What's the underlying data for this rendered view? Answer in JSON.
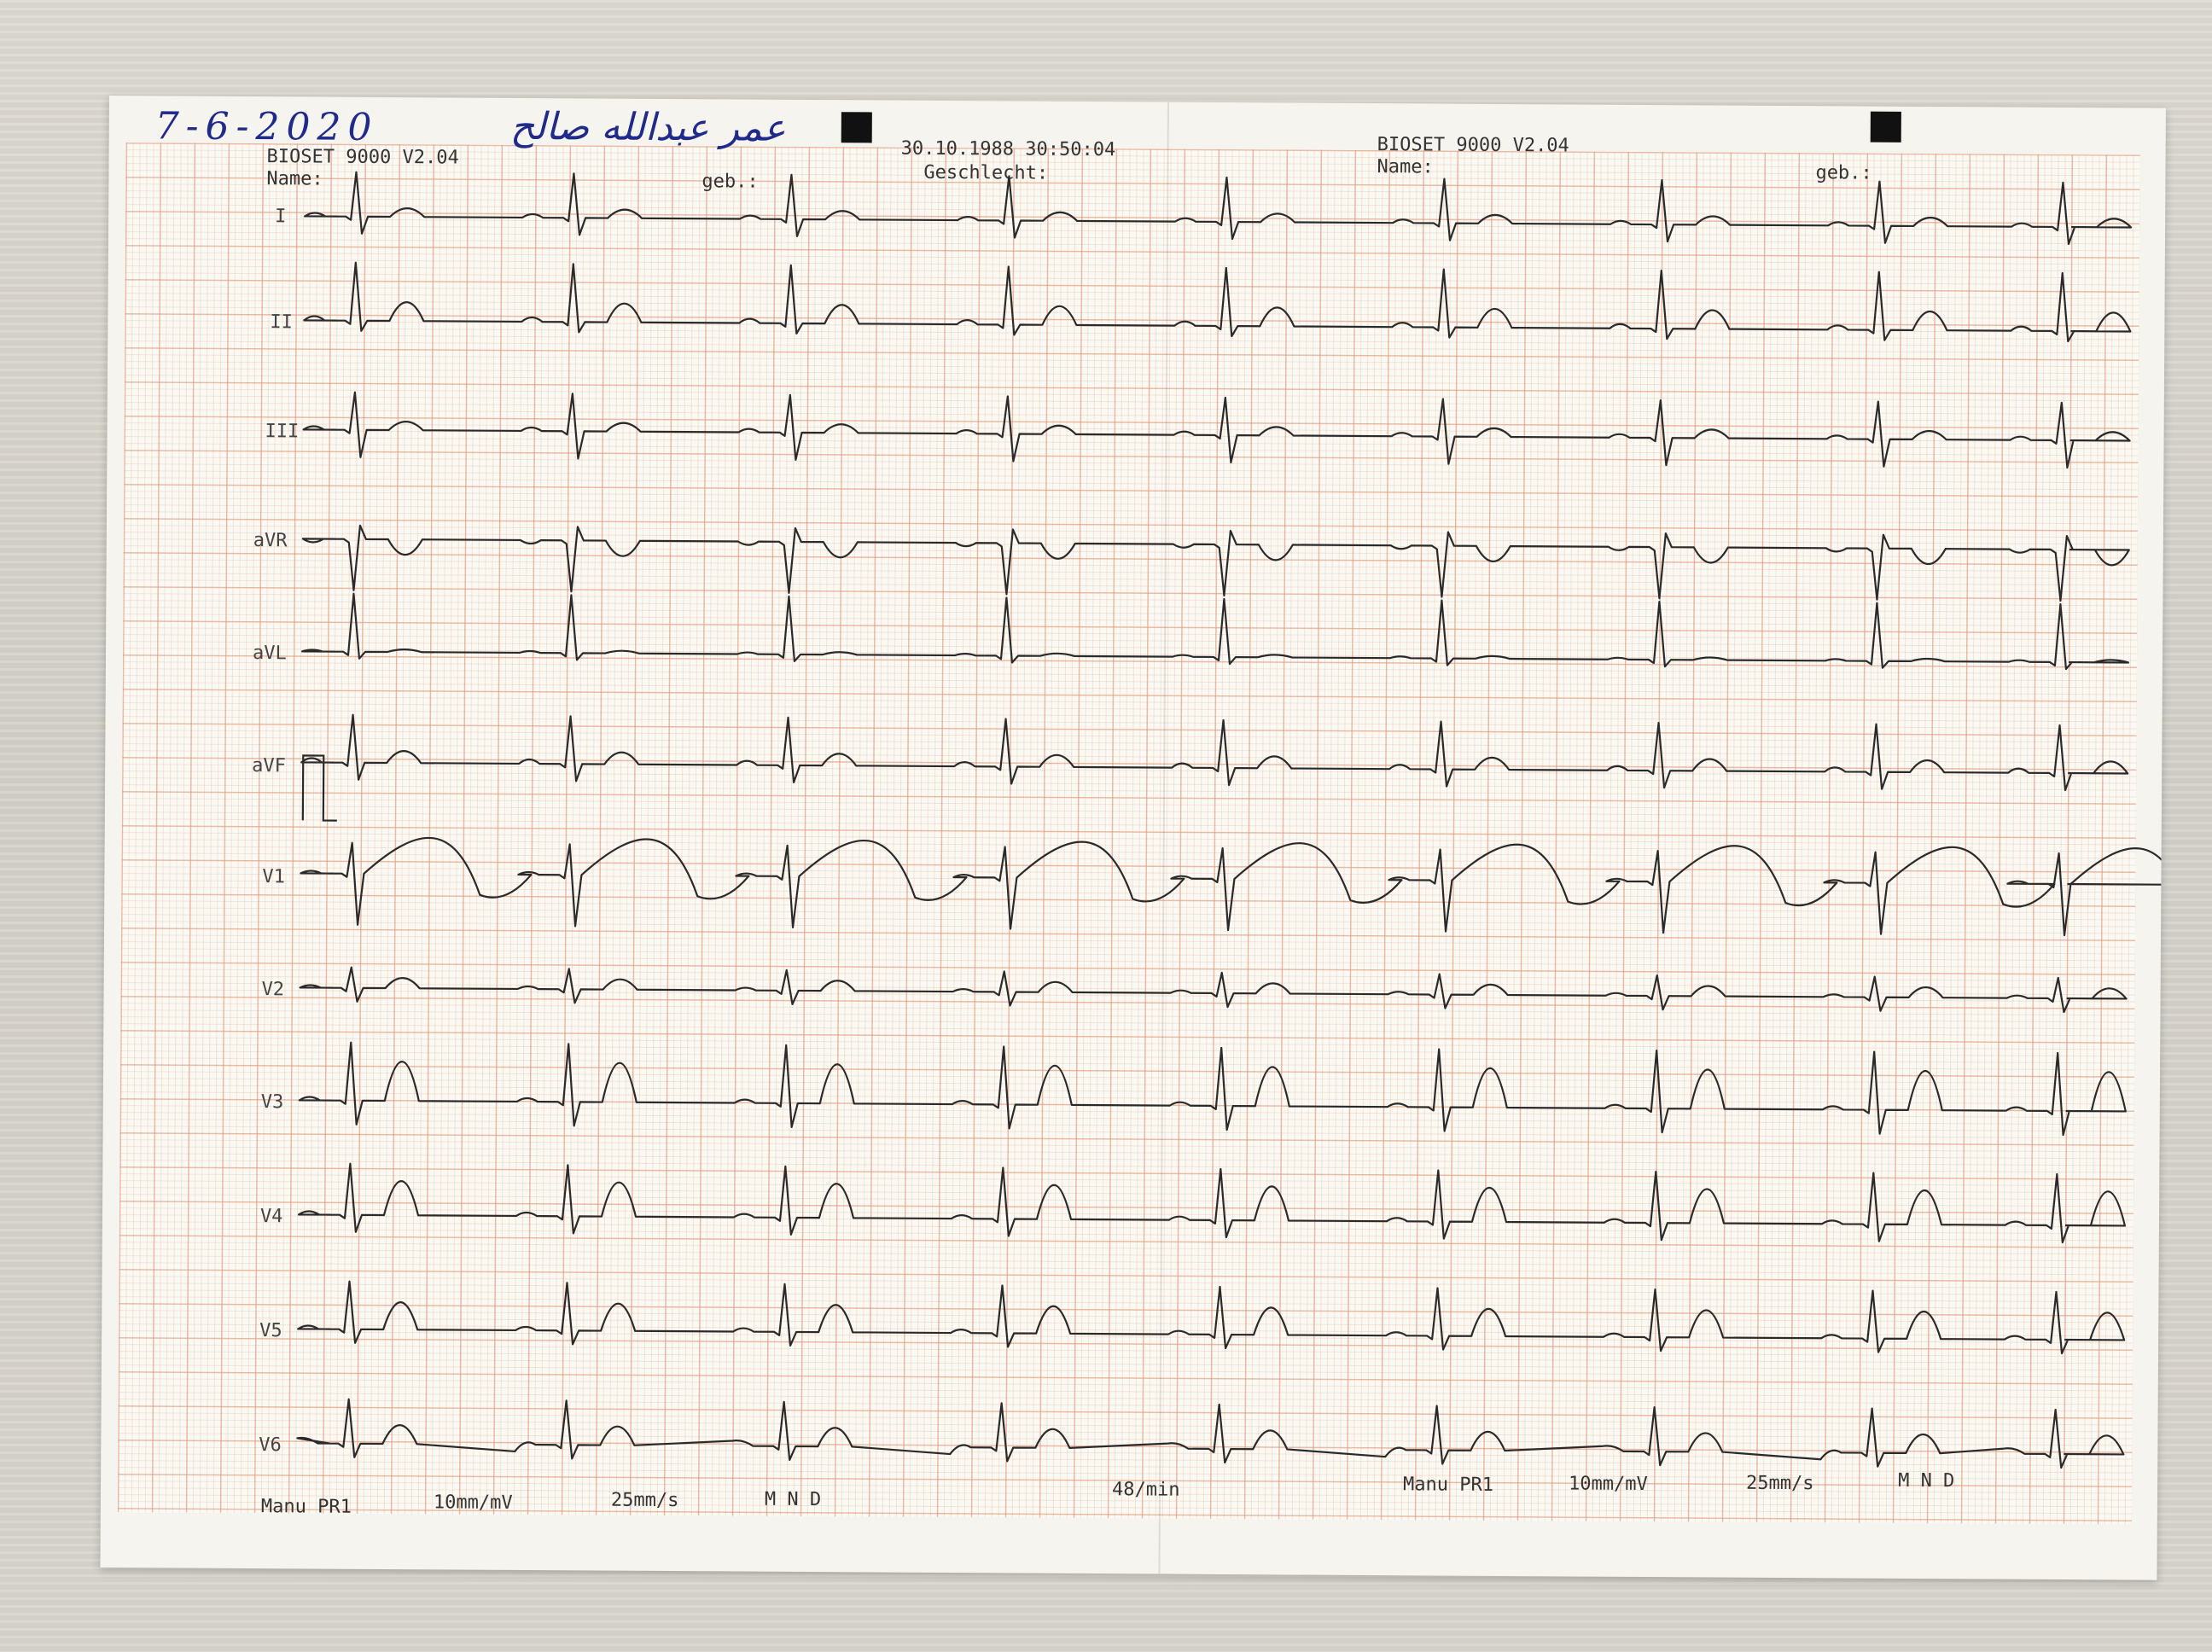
{
  "handwriting": {
    "date": "7-6-2020",
    "name": "عمر عبدالله صالح"
  },
  "header": {
    "device_left": "BIOSET 9000 V2.04",
    "name_label_left": "Name:",
    "geb_label_left": "geb.:",
    "datetime": "30.10.1988 30:50:04",
    "sex_label": "Geschlecht:",
    "device_right": "BIOSET 9000 V2.04",
    "name_label_right": "Name:",
    "geb_label_right": "geb.:"
  },
  "leads": [
    "I",
    "II",
    "III",
    "aVR",
    "aVL",
    "aVF",
    "V1",
    "V2",
    "V3",
    "V4",
    "V5",
    "V6"
  ],
  "footer": {
    "mode_left": "Manu PR1",
    "gain_left": "10mm/mV",
    "speed_left": "25mm/s",
    "filters_left": "M N D",
    "heart_rate": "48/min",
    "mode_right": "Manu PR1",
    "gain_right": "10mm/mV",
    "speed_right": "25mm/s",
    "filters_right": "M N D"
  },
  "colors": {
    "ink": "#1f2a8a",
    "trace": "#2a2a2a",
    "grid": "#e0967a",
    "paper": "#f6f4ef"
  }
}
